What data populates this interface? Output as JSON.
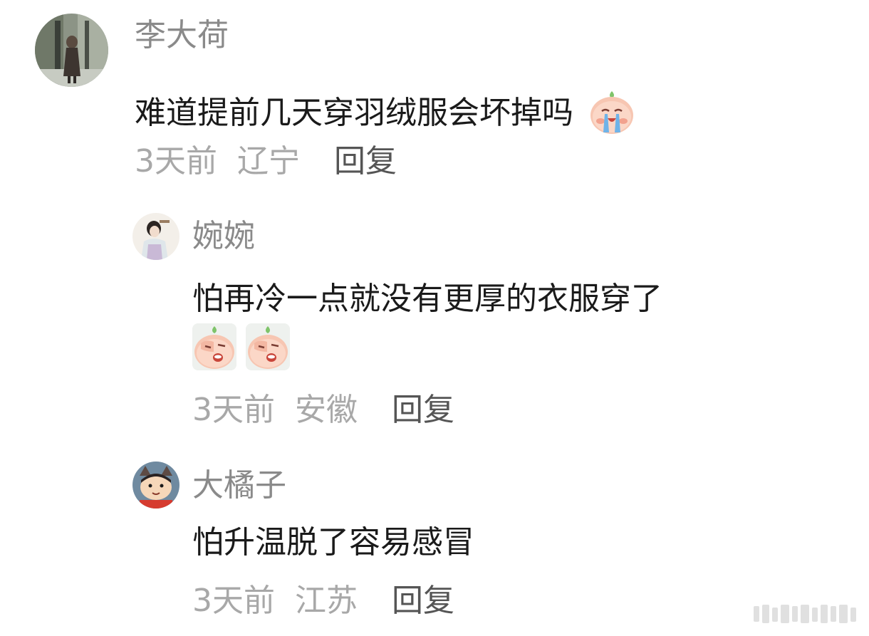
{
  "comments": [
    {
      "username": "李大荷",
      "text": "难道提前几天穿羽绒服会坏掉吗",
      "emojis": [
        "crying-peach-emoji"
      ],
      "time": "3天前",
      "location": "辽宁",
      "reply_label": "回复",
      "is_reply": false
    },
    {
      "username": "婉婉",
      "text": "怕再冷一点就没有更厚的衣服穿了",
      "emojis": [
        "facepalm-peach-emoji",
        "facepalm-peach-emoji"
      ],
      "time": "3天前",
      "location": "安徽",
      "reply_label": "回复",
      "is_reply": true
    },
    {
      "username": "大橘子",
      "text": "怕升温脱了容易感冒",
      "emojis": [],
      "time": "3天前",
      "location": "江苏",
      "reply_label": "回复",
      "is_reply": true
    }
  ],
  "colors": {
    "username": "#8a8a8a",
    "text": "#1a1a1a",
    "meta": "#a8a8a8",
    "reply": "#555555"
  }
}
